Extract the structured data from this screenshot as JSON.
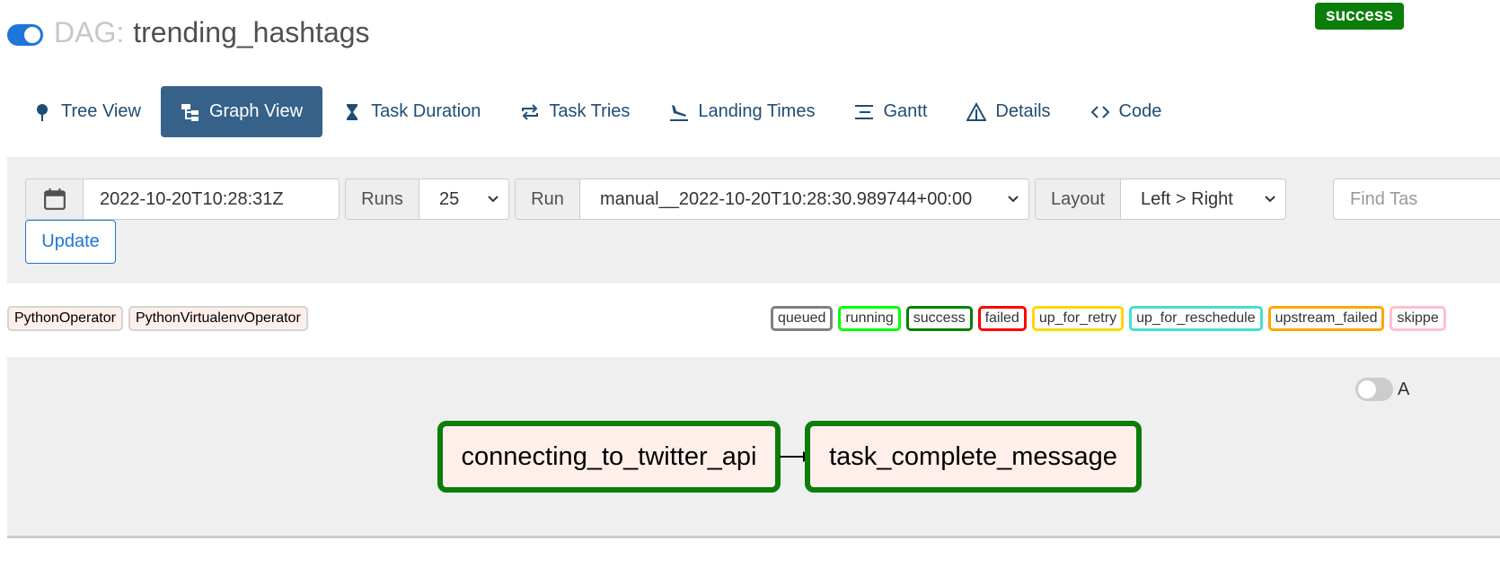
{
  "header": {
    "dag_prefix": "DAG:",
    "dag_id": "trending_hashtags",
    "state": "success",
    "state_color": "#0a7d0a",
    "toggle_on": true
  },
  "nav": {
    "tabs": [
      {
        "label": "Tree View",
        "icon": "map-pin-icon",
        "active": false
      },
      {
        "label": "Graph View",
        "icon": "graph-icon",
        "active": true
      },
      {
        "label": "Task Duration",
        "icon": "hourglass-icon",
        "active": false
      },
      {
        "label": "Task Tries",
        "icon": "repeat-icon",
        "active": false
      },
      {
        "label": "Landing Times",
        "icon": "plane-landing-icon",
        "active": false
      },
      {
        "label": "Gantt",
        "icon": "gantt-icon",
        "active": false
      },
      {
        "label": "Details",
        "icon": "warning-triangle-icon",
        "active": false
      },
      {
        "label": "Code",
        "icon": "code-icon",
        "active": false
      }
    ]
  },
  "controls": {
    "base_date": "2022-10-20T10:28:31Z",
    "runs_label": "Runs",
    "runs_value": "25",
    "run_label": "Run",
    "run_value": "manual__2022-10-20T10:28:30.989744+00:00",
    "layout_label": "Layout",
    "layout_value": "Left > Right",
    "find_task_placeholder": "Find Tas",
    "update_label": "Update"
  },
  "legend": {
    "operators": [
      "PythonOperator",
      "PythonVirtualenvOperator"
    ],
    "states": [
      {
        "label": "queued",
        "color": "#808080"
      },
      {
        "label": "running",
        "color": "#00ff00"
      },
      {
        "label": "success",
        "color": "#008000"
      },
      {
        "label": "failed",
        "color": "#ff0000"
      },
      {
        "label": "up_for_retry",
        "color": "#ffd700"
      },
      {
        "label": "up_for_reschedule",
        "color": "#40e0d0"
      },
      {
        "label": "upstream_failed",
        "color": "#ffa500"
      },
      {
        "label": "skippe",
        "color": "#ffc0cb"
      }
    ]
  },
  "graph": {
    "auto_refresh_label": "A",
    "auto_refresh_on": false,
    "nodes": [
      {
        "label": "connecting_to_twitter_api",
        "state": "success"
      },
      {
        "label": "task_complete_message",
        "state": "success"
      }
    ]
  }
}
